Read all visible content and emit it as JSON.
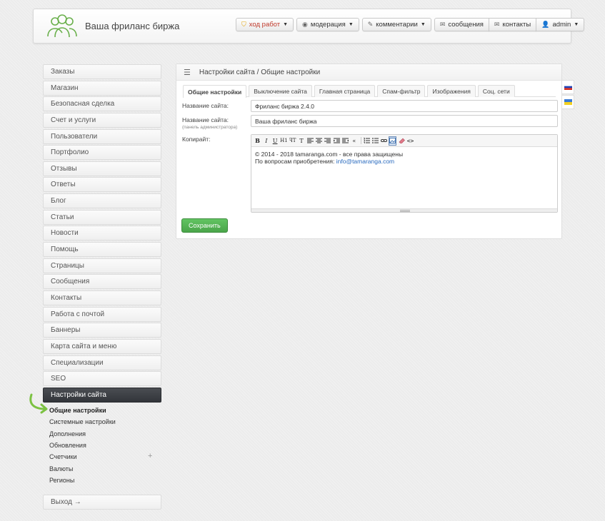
{
  "header": {
    "site_title": "Ваша фриланс биржа",
    "nav": [
      {
        "label": "ход работ",
        "icon": "shield-icon"
      },
      {
        "label": "модерация",
        "icon": "eye-icon"
      },
      {
        "label": "комментарии",
        "icon": "pencil-icon"
      }
    ],
    "messages_label": "сообщения",
    "contacts_label": "контакты",
    "user_label": "admin"
  },
  "sidebar": {
    "items": [
      "Заказы",
      "Магазин",
      "Безопасная сделка",
      "Счет и услуги",
      "Пользователи",
      "Портфолио",
      "Отзывы",
      "Ответы",
      "Блог",
      "Статьи",
      "Новости",
      "Помощь",
      "Страницы",
      "Сообщения",
      "Контакты",
      "Работа с почтой",
      "Баннеры",
      "Карта сайта и меню",
      "Специализации",
      "SEO",
      "Настройки сайта"
    ],
    "active": "Настройки сайта",
    "submenu": [
      "Общие настройки",
      "Системные настройки",
      "Дополнения",
      "Обновления",
      "Счетчики",
      "Валюты",
      "Регионы"
    ],
    "submenu_current": "Общие настройки",
    "logout_label": "Выход →"
  },
  "panel": {
    "breadcrumb": "Настройки сайта / Общие настройки",
    "tabs": [
      "Общие настройки",
      "Выключение сайта",
      "Главная страница",
      "Спам-фильтр",
      "Изображения",
      "Соц. сети"
    ],
    "active_tab": "Общие настройки",
    "fields": {
      "site_name_label": "Название сайта:",
      "site_name_value": "Фриланс биржа 2.4.0",
      "admin_name_label": "Название сайта:",
      "admin_name_hint": "(панель администратора)",
      "admin_name_value": "Ваша фриланс биржа",
      "copyright_label": "Копирайт:",
      "copyright_line1": "© 2014 - 2018 tamaranga.com - все права защищены",
      "copyright_line2_prefix": "По вопросам приобретения: ",
      "copyright_email": "info@tamaranga.com"
    },
    "save_label": "Сохранить"
  },
  "languages": [
    "ru-flag",
    "ua-flag"
  ],
  "colors": {
    "accent_green": "#5cb85c",
    "active_menu": "#3a3d42",
    "link": "#2a6bbf"
  }
}
